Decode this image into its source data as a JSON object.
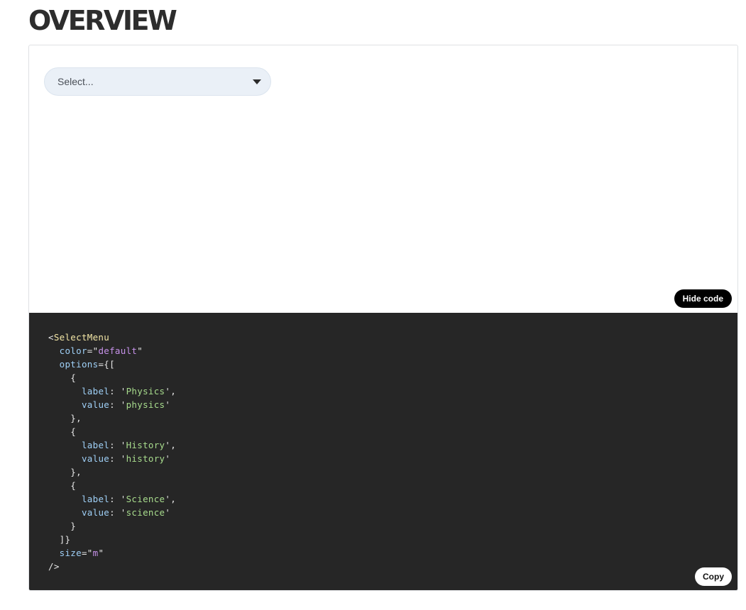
{
  "page": {
    "title": "OVERVIEW"
  },
  "preview": {
    "select": {
      "placeholder": "Select..."
    },
    "hide_code_label": "Hide code"
  },
  "code": {
    "copy_label": "Copy",
    "component": "SelectMenu",
    "attrs": {
      "color_name": "color",
      "color_value": "default",
      "options_name": "options",
      "size_name": "size",
      "size_value": "m"
    },
    "options": [
      {
        "label": "Physics",
        "value": "physics"
      },
      {
        "label": "History",
        "value": "history"
      },
      {
        "label": "Science",
        "value": "science"
      }
    ],
    "keys": {
      "label": "label",
      "value": "value"
    }
  },
  "colors": {
    "code_background": "#262626",
    "tag": "#f3e6a6",
    "attribute": "#9fd0f7",
    "attribute_value": "#c792ea",
    "string": "#a8dc8d"
  }
}
